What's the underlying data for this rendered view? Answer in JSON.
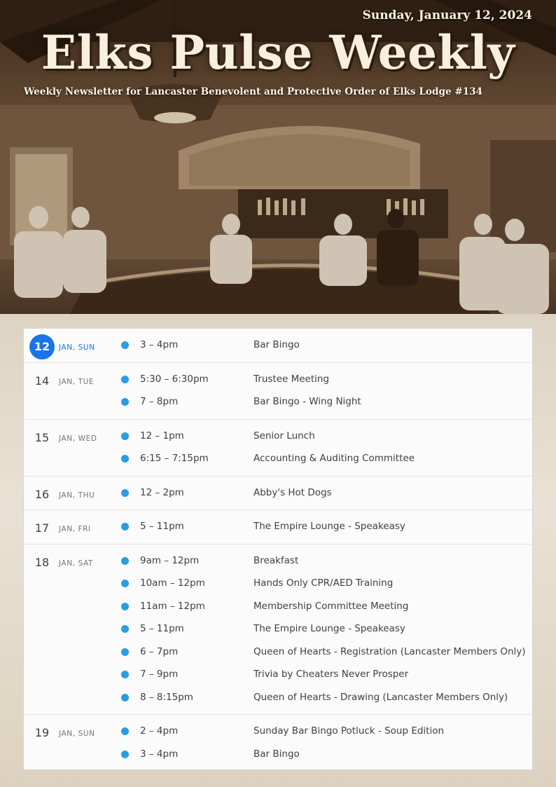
{
  "header": {
    "date": "Sunday, January 12, 2024",
    "title": "Elks Pulse Weekly",
    "tagline": "Weekly Newsletter for Lancaster Benevolent and Protective Order of Elks Lodge #134"
  },
  "colors": {
    "accent": "#1a73e8",
    "event_dot": "#2a9de1",
    "text": "#3c4043",
    "muted": "#70757a"
  },
  "agenda": {
    "days": [
      {
        "num": "12",
        "label": "JAN, SUN",
        "today": true,
        "events": [
          {
            "time": "3 – 4pm",
            "title": "Bar Bingo"
          }
        ]
      },
      {
        "num": "14",
        "label": "JAN, TUE",
        "today": false,
        "events": [
          {
            "time": "5:30 – 6:30pm",
            "title": "Trustee Meeting"
          },
          {
            "time": "7 – 8pm",
            "title": "Bar Bingo - Wing Night"
          }
        ]
      },
      {
        "num": "15",
        "label": "JAN, WED",
        "today": false,
        "events": [
          {
            "time": "12 – 1pm",
            "title": "Senior Lunch"
          },
          {
            "time": "6:15 – 7:15pm",
            "title": "Accounting & Auditing Committee"
          }
        ]
      },
      {
        "num": "16",
        "label": "JAN, THU",
        "today": false,
        "events": [
          {
            "time": "12 – 2pm",
            "title": "Abby's Hot Dogs"
          }
        ]
      },
      {
        "num": "17",
        "label": "JAN, FRI",
        "today": false,
        "events": [
          {
            "time": "5 – 11pm",
            "title": "The Empire Lounge - Speakeasy"
          }
        ]
      },
      {
        "num": "18",
        "label": "JAN, SAT",
        "today": false,
        "events": [
          {
            "time": "9am – 12pm",
            "title": "Breakfast"
          },
          {
            "time": "10am – 12pm",
            "title": "Hands Only CPR/AED Training"
          },
          {
            "time": "11am – 12pm",
            "title": "Membership Committee Meeting"
          },
          {
            "time": "5 – 11pm",
            "title": "The Empire Lounge - Speakeasy"
          },
          {
            "time": "6 – 7pm",
            "title": "Queen of Hearts - Registration (Lancaster Members Only)"
          },
          {
            "time": "7 – 9pm",
            "title": "Trivia by Cheaters Never Prosper"
          },
          {
            "time": "8 – 8:15pm",
            "title": "Queen of Hearts - Drawing (Lancaster Members Only)"
          }
        ]
      },
      {
        "num": "19",
        "label": "JAN, SUN",
        "today": false,
        "events": [
          {
            "time": "2 – 4pm",
            "title": "Sunday Bar Bingo Potluck - Soup Edition"
          },
          {
            "time": "3 – 4pm",
            "title": "Bar Bingo"
          }
        ]
      }
    ]
  }
}
